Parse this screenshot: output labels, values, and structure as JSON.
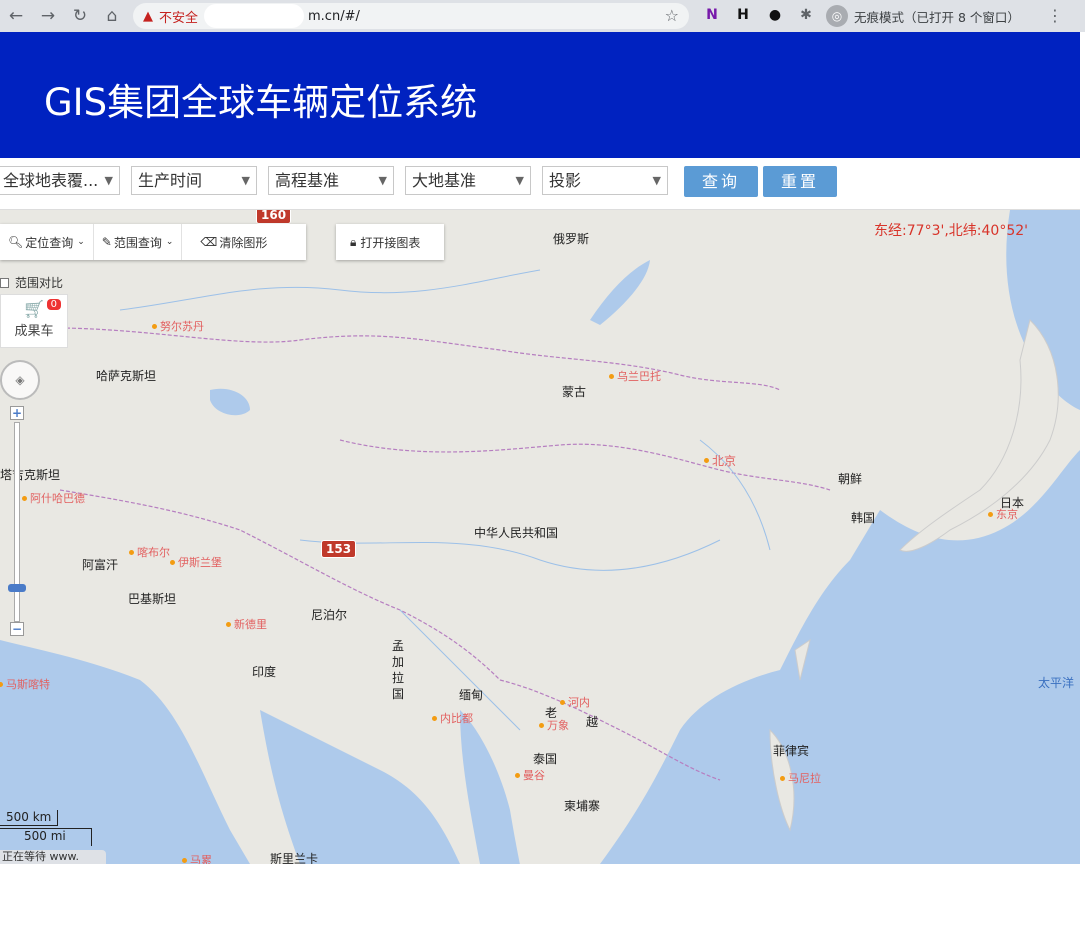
{
  "browser": {
    "warning": "不安全",
    "url": "m.cn/#/",
    "incognito_text": "无痕模式（已打开 8 个窗口）"
  },
  "app": {
    "title": "GIS集团全球车辆定位系统"
  },
  "filters": {
    "land_cover": "全球地表覆...",
    "production_time": "生产时间",
    "elevation_datum": "高程基准",
    "geodetic_datum": "大地基准",
    "projection": "投影",
    "query_btn": "查询",
    "reset_btn": "重置"
  },
  "toolbar": {
    "locate": "定位查询",
    "range": "范围查询",
    "clear": "清除图形",
    "open_index": "打开接图表"
  },
  "side": {
    "compare": "范围对比",
    "cart": "成果车",
    "cart_count": "0"
  },
  "map": {
    "coords": "东经:77°3',北纬:40°52'",
    "markers": [
      "160",
      "153"
    ],
    "countries": {
      "russia": "俄罗斯",
      "kazakhstan": "哈萨克斯坦",
      "mongolia": "蒙古",
      "china": "中华人民共和国",
      "nkorea": "朝鲜",
      "skorea": "韩国",
      "japan": "日本",
      "afghanistan": "阿富汗",
      "pakistan": "巴基斯坦",
      "nepal": "尼泊尔",
      "india": "印度",
      "bangladesh": "孟加拉国",
      "myanmar": "缅甸",
      "laos": "老",
      "vietnam": "越",
      "thailand": "泰国",
      "cambodia": "柬埔寨",
      "philippines": "菲律宾",
      "srilanka": "斯里兰卡",
      "tajik": "塔吉克斯坦"
    },
    "cities": {
      "urumqi": "努尔苏丹",
      "ulaanbaatar": "乌兰巴托",
      "beijing": "北京",
      "tokyo": "东京",
      "ashgabat": "阿什哈巴德",
      "kabul": "喀布尔",
      "islamabad": "伊斯兰堡",
      "newdelhi": "新德里",
      "hanoi": "河内",
      "vientiane": "万象",
      "naypyidaw": "内比都",
      "bangkok": "曼谷",
      "manila": "马尼拉",
      "muscat": "马斯喀特",
      "male": "马累"
    },
    "ocean": "太平洋",
    "scale_km": "500 km",
    "scale_mi": "500 mi",
    "status": "正在等待 www."
  }
}
